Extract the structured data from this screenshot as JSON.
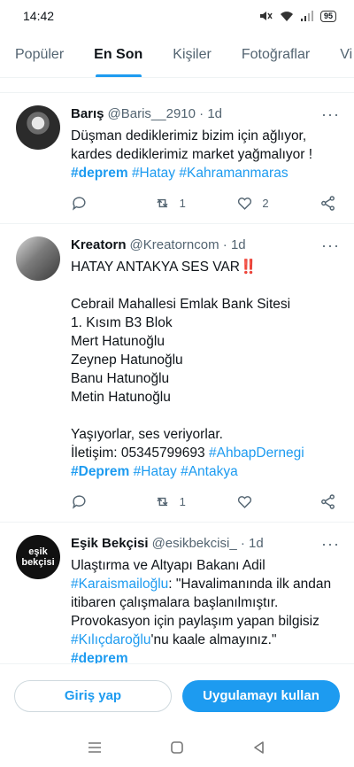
{
  "status": {
    "time": "14:42",
    "battery": "95"
  },
  "tabs": [
    {
      "label": "Popüler"
    },
    {
      "label": "En Son"
    },
    {
      "label": "Kişiler"
    },
    {
      "label": "Fotoğraflar"
    },
    {
      "label": "Vi"
    }
  ],
  "tweets": [
    {
      "name": "Barış",
      "handle": "@Baris__2910 · 1d",
      "text": "Düşman dediklerimiz bizim için ağlıyor, kardes dediklerimiz market yağmalıyor !",
      "tags": [
        {
          "text": "#deprem"
        },
        {
          "text": "#Hatay"
        },
        {
          "text": "#Kahramanmaras"
        }
      ],
      "retweets": "1",
      "likes": "2"
    },
    {
      "name": "Kreatorn",
      "handle": "@Kreatorncom · 1d",
      "line1": "HATAY ANTAKYA SES VAR",
      "alert": "‼️",
      "text2": "Cebrail Mahallesi Emlak Bank Sitesi\n1. Kısım B3 Blok\nMert Hatunoğlu\nZeynep Hatunoğlu\nBanu Hatunoğlu\nMetin Hatunoğlu",
      "text3": "Yaşıyorlar, ses veriyorlar.",
      "contact": "İletişim: 05345799693",
      "tag_inline": "#AhbapDernegi",
      "tags": [
        {
          "text": "#Deprem"
        },
        {
          "text": "#Hatay"
        },
        {
          "text": "#Antakya"
        }
      ],
      "retweets": "1",
      "likes": ""
    },
    {
      "name": "Eşik Bekçisi",
      "handle": "@esikbekcisi_ · 1d",
      "avatar_line1": "eşik",
      "avatar_line2": "bekçisi",
      "text_a": "Ulaştırma ve Altyapı Bakanı Adil",
      "tag_a": "#Karaismailoğlu",
      "text_b": ": \"Havalimanında ilk andan itibaren çalışmalara başlanılmıştır. Provokasyon için paylaşım yapan bilgisiz",
      "tag_b": "#Kılıçdaroğlu",
      "text_c": "'nu kaale almayınız.\"",
      "tag_c": "#deprem"
    }
  ],
  "bottom": {
    "login": "Giriş yap",
    "app": "Uygulamayı kullan"
  },
  "colors": {
    "accent": "#1d9bf0",
    "text": "#0f1419",
    "muted": "#536471"
  }
}
